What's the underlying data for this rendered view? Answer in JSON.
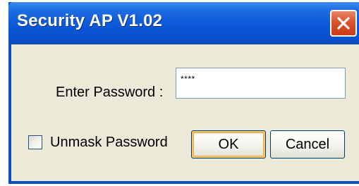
{
  "window": {
    "title": "Security AP V1.02"
  },
  "titlebar": {
    "close_icon": "close-icon"
  },
  "form": {
    "password_label": "Enter Password :",
    "password_value": "****",
    "unmask_label": "Unmask Password",
    "unmask_checked": false
  },
  "buttons": {
    "ok_label": "OK",
    "cancel_label": "Cancel"
  },
  "colors": {
    "titlebar": "#0a50cf",
    "client_bg": "#ece9d8",
    "close_button": "#d9532d",
    "default_button_highlight": "#f8c868"
  }
}
